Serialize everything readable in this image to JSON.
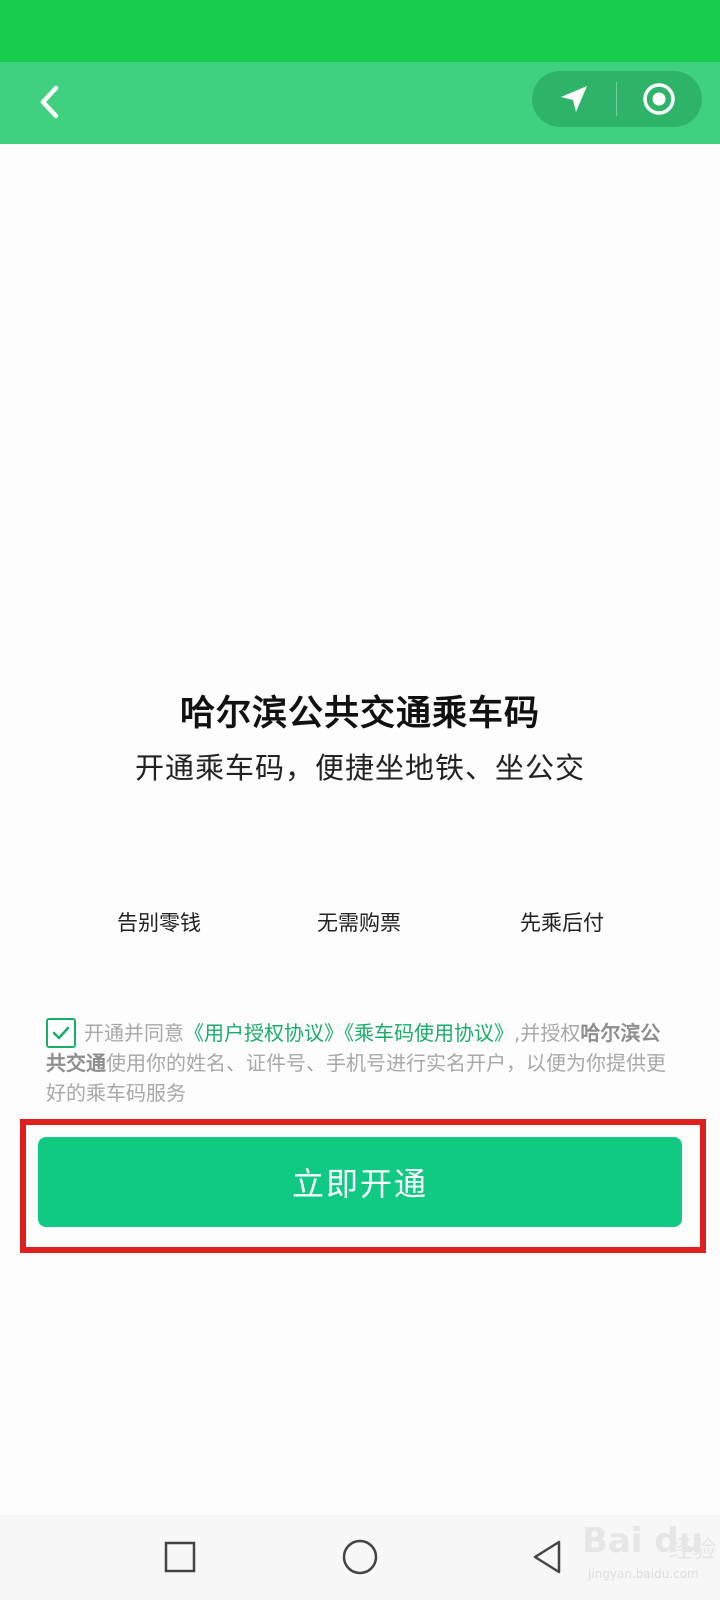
{
  "header": {
    "back_icon": "chevron-left-icon",
    "location_icon": "location-arrow-icon",
    "close_icon": "target-circle-icon"
  },
  "main": {
    "title": "哈尔滨公共交通乘车码",
    "subtitle": "开通乘车码，便捷坐地铁、坐公交",
    "features": [
      "告别零钱",
      "无需购票",
      "先乘后付"
    ]
  },
  "agreement": {
    "checked": true,
    "prefix": "开通并同意",
    "link_user": "《用户授权协议》",
    "link_ride": "《乘车码使用协议》",
    "middle": ",并授权",
    "org": "哈尔滨公共交通",
    "suffix": "使用你的姓名、证件号、手机号进行实名开户，以便为你提供更好的乘车码服务"
  },
  "action": {
    "open_button": "立即开通"
  },
  "watermark": {
    "logo": "Bai du",
    "jingyan": "经验",
    "url": "jingyan.baidu.com"
  },
  "colors": {
    "status_bar": "#18cd4d",
    "nav_bar": "#3fd17f",
    "primary_button": "#10c982",
    "link": "#1aad6a",
    "highlight": "#e02020"
  }
}
